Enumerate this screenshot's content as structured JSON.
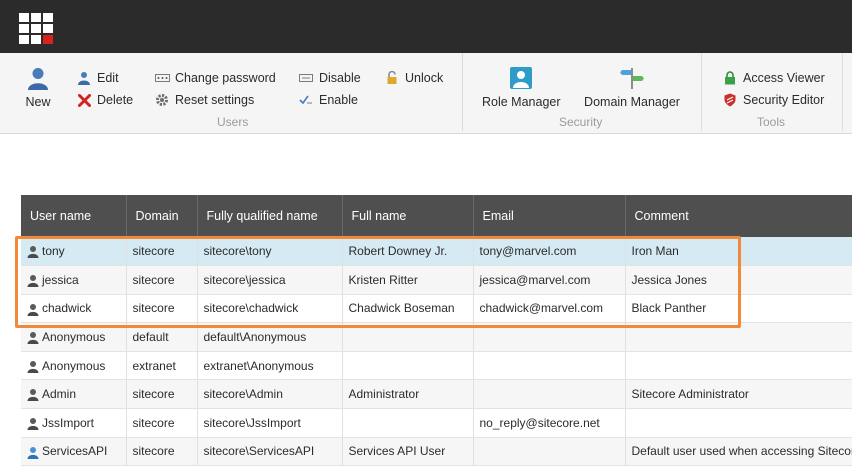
{
  "ribbon": {
    "users_group": {
      "new_label": "New",
      "edit_label": "Edit",
      "delete_label": "Delete",
      "change_password_label": "Change password",
      "reset_settings_label": "Reset settings",
      "disable_label": "Disable",
      "enable_label": "Enable",
      "unlock_label": "Unlock",
      "group_label": "Users"
    },
    "security_group": {
      "role_manager_label": "Role Manager",
      "domain_manager_label": "Domain Manager",
      "group_label": "Security"
    },
    "tools_group": {
      "access_viewer_label": "Access Viewer",
      "security_editor_label": "Security Editor",
      "group_label": "Tools"
    }
  },
  "table": {
    "columns": [
      "User name",
      "Domain",
      "Fully qualified name",
      "Full name",
      "Email",
      "Comment"
    ],
    "rows": [
      {
        "user": "tony",
        "domain": "sitecore",
        "fqn": "sitecore\\tony",
        "full_name": "Robert Downey Jr.",
        "email": "tony@marvel.com",
        "comment": "Iron Man",
        "selected": true
      },
      {
        "user": "jessica",
        "domain": "sitecore",
        "fqn": "sitecore\\jessica",
        "full_name": "Kristen Ritter",
        "email": "jessica@marvel.com",
        "comment": "Jessica Jones"
      },
      {
        "user": "chadwick",
        "domain": "sitecore",
        "fqn": "sitecore\\chadwick",
        "full_name": "Chadwick Boseman",
        "email": "chadwick@marvel.com",
        "comment": "Black Panther"
      },
      {
        "user": "Anonymous",
        "domain": "default",
        "fqn": "default\\Anonymous",
        "full_name": "",
        "email": "",
        "comment": ""
      },
      {
        "user": "Anonymous",
        "domain": "extranet",
        "fqn": "extranet\\Anonymous",
        "full_name": "",
        "email": "",
        "comment": ""
      },
      {
        "user": "Admin",
        "domain": "sitecore",
        "fqn": "sitecore\\Admin",
        "full_name": "Administrator",
        "email": "",
        "comment": "Sitecore Administrator"
      },
      {
        "user": "JssImport",
        "domain": "sitecore",
        "fqn": "sitecore\\JssImport",
        "full_name": "",
        "email": "no_reply@sitecore.net",
        "comment": ""
      },
      {
        "user": "ServicesAPI",
        "domain": "sitecore",
        "fqn": "sitecore\\ServicesAPI",
        "full_name": "Services API User",
        "email": "",
        "comment": "Default user used when accessing Sitecore"
      }
    ]
  },
  "colors": {
    "accent_highlight": "#f0893a",
    "selected_row": "#d6eaf4",
    "header_bg": "#4f4f4f",
    "topbar_bg": "#2b2b2b"
  },
  "icons": [
    "app-launcher-icon",
    "user-new-icon",
    "edit-user-icon",
    "delete-x-icon",
    "change-password-icon",
    "reset-settings-gear-icon",
    "disable-icon",
    "enable-icon",
    "unlock-icon",
    "role-manager-icon",
    "domain-manager-icon",
    "access-viewer-lock-icon",
    "security-editor-icon",
    "user-icon",
    "service-user-icon"
  ]
}
